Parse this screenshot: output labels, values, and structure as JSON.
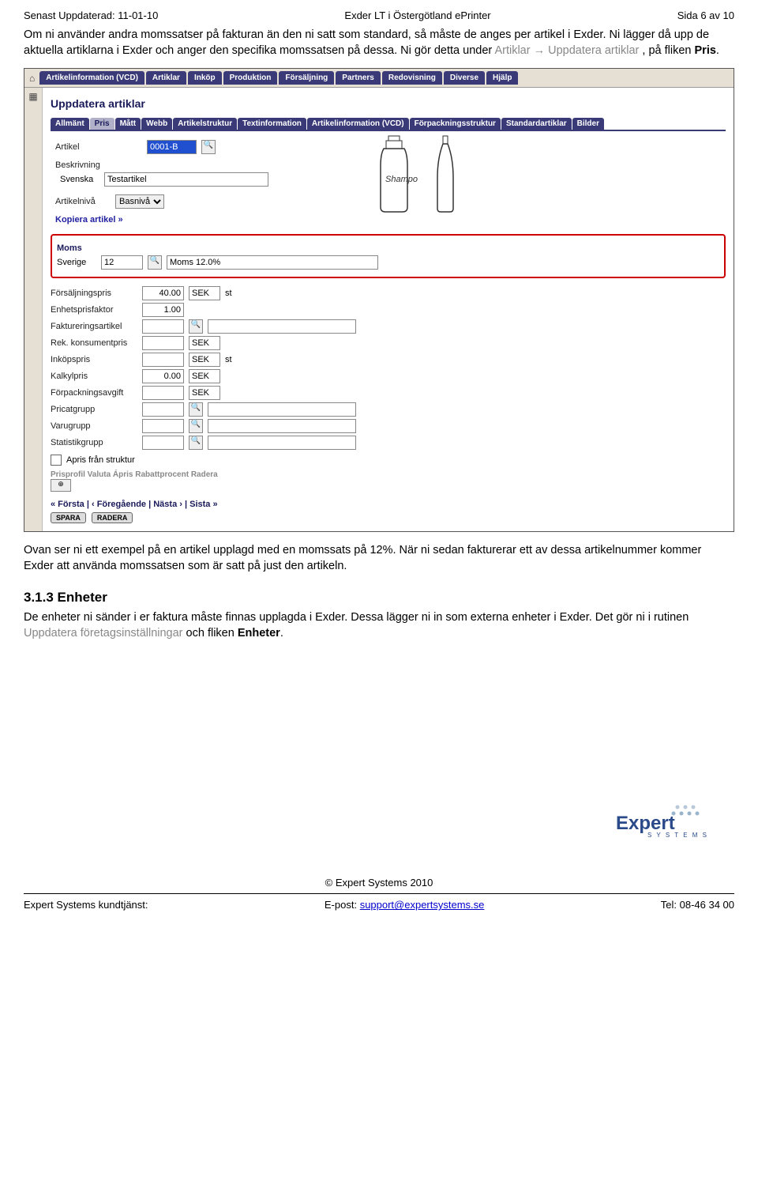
{
  "header": {
    "left": "Senast Uppdaterad: 11-01-10",
    "center": "Exder LT i Östergötland ePrinter",
    "right": "Sida 6 av 10"
  },
  "para1": "Om ni använder andra momssatser på fakturan än den ni satt som standard, så måste de anges per artikel i Exder. Ni lägger då upp de aktuella artiklarna i Exder och anger den specifika momssatsen på dessa. Ni gör detta under ",
  "para1_grey": "Artiklar → Uppdatera artiklar",
  "para1_tail": ", på fliken ",
  "para1_bold": "Pris",
  "menu": [
    "Artikelinformation (VCD)",
    "Artiklar",
    "Inköp",
    "Produktion",
    "Försäljning",
    "Partners",
    "Redovisning",
    "Diverse",
    "Hjälp"
  ],
  "pageTitle": "Uppdatera artiklar",
  "subtabs": [
    "Allmänt",
    "Pris",
    "Mått",
    "Webb",
    "Artikelstruktur",
    "Textinformation",
    "Artikelinformation (VCD)",
    "Förpackningsstruktur",
    "Standardartiklar",
    "Bilder"
  ],
  "form": {
    "artikel_label": "Artikel",
    "artikel_value": "0001-B",
    "beskrivning_label": "Beskrivning",
    "svenska_label": "Svenska",
    "svenska_value": "Testartikel",
    "niva_label": "Artikelnivå",
    "niva_value": "Basnivå",
    "kopiera": "Kopiera artikel »"
  },
  "moms": {
    "header": "Moms",
    "sverige_label": "Sverige",
    "sverige_value": "12",
    "sverige_desc": "Moms 12.0%"
  },
  "rows": [
    {
      "label": "Försäljningspris",
      "val": "40.00",
      "unit": "SEK",
      "suf": "st"
    },
    {
      "label": "Enhetsprisfaktor",
      "val": "1.00",
      "unit": "",
      "suf": ""
    },
    {
      "label": "Faktureringsartikel",
      "val": "",
      "unit": "",
      "suf": "",
      "mag": true,
      "desc": true
    },
    {
      "label": "Rek. konsumentpris",
      "val": "",
      "unit": "SEK",
      "suf": ""
    },
    {
      "label": "Inköpspris",
      "val": "",
      "unit": "SEK",
      "suf": "st"
    },
    {
      "label": "Kalkylpris",
      "val": "0.00",
      "unit": "SEK",
      "suf": ""
    },
    {
      "label": "Förpackningsavgift",
      "val": "",
      "unit": "SEK",
      "suf": ""
    },
    {
      "label": "Pricatgrupp",
      "val": "",
      "unit": "",
      "suf": "",
      "mag": true,
      "desc": true
    },
    {
      "label": "Varugrupp",
      "val": "",
      "unit": "",
      "suf": "",
      "mag": true,
      "desc": true
    },
    {
      "label": "Statistikgrupp",
      "val": "",
      "unit": "",
      "suf": "",
      "mag": true,
      "desc": true
    }
  ],
  "apris_label": "Apris från struktur",
  "grayHeader": "Prisprofil Valuta   Ápris Rabattprocent Radera",
  "nav": "« Första | ‹ Föregående | Nästa › | Sista »",
  "btnSave": "SPARA",
  "btnDelete": "RADERA",
  "para2": "Ovan ser ni ett exempel på en artikel upplagd med en momssats på 12%. När ni sedan fakturerar ett av dessa artikelnummer kommer Exder att använda momssatsen som är satt på just den artikeln.",
  "h3": "3.1.3  Enheter",
  "para3a": "De enheter ni sänder i er faktura måste finnas upplagda i Exder. Dessa lägger ni in som externa enheter i Exder. Det gör ni i rutinen ",
  "para3grey": "Uppdatera företagsinställningar",
  "para3b": " och fliken ",
  "para3bold": "Enheter",
  "footer": {
    "copyright": "© Expert Systems 2010",
    "left": "Expert Systems kundtjänst:",
    "centerPrefix": "E-post: ",
    "centerLink": "support@expertsystems.se",
    "right": "Tel: 08-46 34 00",
    "logo1": "Expert",
    "logo2": "S Y S T E M S"
  }
}
